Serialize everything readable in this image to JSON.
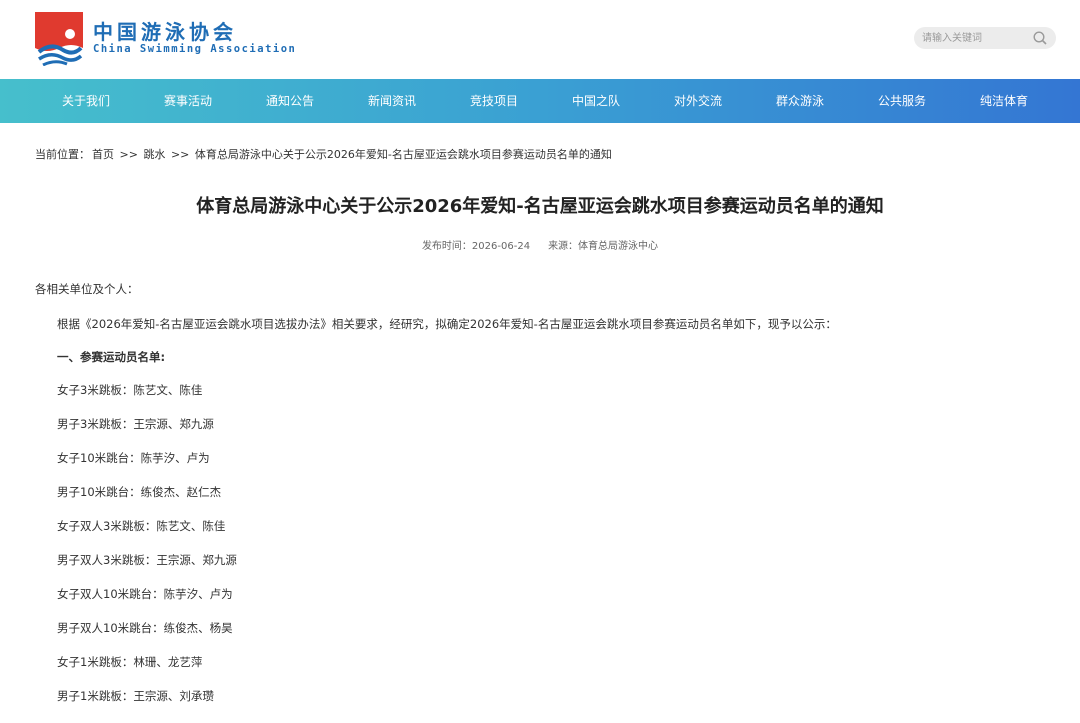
{
  "header": {
    "logo_cn": "中国游泳协会",
    "logo_en": "China Swimming Association",
    "search_placeholder": "请输入关键词",
    "brand_blue": "#1f6db5",
    "brand_red": "#e03a2f"
  },
  "nav": {
    "items": [
      "关于我们",
      "赛事活动",
      "通知公告",
      "新闻资讯",
      "竞技项目",
      "中国之队",
      "对外交流",
      "群众游泳",
      "公共服务",
      "纯洁体育"
    ],
    "gradient_start": "#46bfcc",
    "gradient_end": "#3476d3"
  },
  "breadcrumb": {
    "prefix": "当前位置：",
    "home": "首页",
    "sep1": ">>",
    "category": "跳水",
    "sep2": ">>",
    "current": "体育总局游泳中心关于公示2026年爱知-名古屋亚运会跳水项目参赛运动员名单的通知"
  },
  "article": {
    "title": "体育总局游泳中心关于公示2026年爱知-名古屋亚运会跳水项目参赛运动员名单的通知",
    "publish_time": "发布时间：2026-06-24",
    "source": "来源：体育总局游泳中心",
    "greeting": "各相关单位及个人：",
    "intro": "根据《2026年爱知-名古屋亚运会跳水项目选拔办法》相关要求，经研究，拟确定2026年爱知-名古屋亚运会跳水项目参赛运动员名单如下，现予以公示：",
    "section_title": "一、参赛运动员名单:",
    "athletes": [
      "女子3米跳板：陈艺文、陈佳",
      "男子3米跳板：王宗源、郑九源",
      "女子10米跳台：陈芋汐、卢为",
      "男子10米跳台：练俊杰、赵仁杰",
      "女子双人3米跳板：陈艺文、陈佳",
      "男子双人3米跳板：王宗源、郑九源",
      "女子双人10米跳台：陈芋汐、卢为",
      "男子双人10米跳台：练俊杰、杨昊",
      "女子1米跳板：林珊、龙艺萍",
      "男子1米跳板：王宗源、刘承瓒"
    ]
  }
}
